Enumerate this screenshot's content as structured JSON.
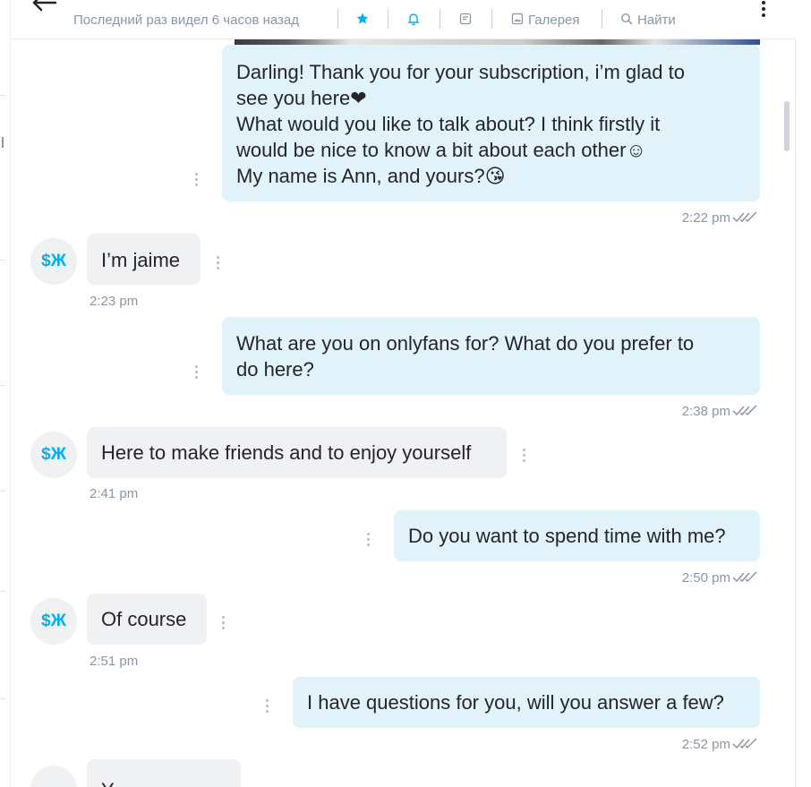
{
  "header": {
    "status": "Последний раз видел 6 часов назад",
    "gallery_label": "Галерея",
    "search_label": "Найти"
  },
  "chat": {
    "user_initials": "$Ж",
    "messages": [
      {
        "direction": "out",
        "lines": [
          "Darling! Thank you for your subscription, i’m glad to",
          "see you here❤",
          "What would you like to talk about? I think firstly it",
          "would be nice to know a bit about each other☺",
          "My name is Ann, and yours?😘"
        ],
        "time": "2:22 pm",
        "read": true
      },
      {
        "direction": "in",
        "text": "I’m jaime",
        "time": "2:23 pm"
      },
      {
        "direction": "out",
        "lines": [
          "What are you on onlyfans for? What do you prefer to",
          "do here?"
        ],
        "time": "2:38 pm",
        "read": true
      },
      {
        "direction": "in",
        "text": "Here to make friends and to enjoy yourself",
        "time": "2:41 pm"
      },
      {
        "direction": "out",
        "lines": [
          "Do you want to spend time with me?"
        ],
        "time": "2:50 pm",
        "read": true
      },
      {
        "direction": "in",
        "text": "Of course",
        "time": "2:51 pm"
      },
      {
        "direction": "out",
        "lines": [
          "I have questions for you, will you answer a few?"
        ],
        "time": "2:52 pm",
        "read": true
      },
      {
        "direction": "in",
        "text": "Y...",
        "time": ""
      }
    ]
  },
  "colors": {
    "accent": "#00aff0",
    "outgoing_bubble": "#e2f2fb",
    "incoming_bubble": "#f0f1f3",
    "meta_text": "#8a96a3"
  }
}
